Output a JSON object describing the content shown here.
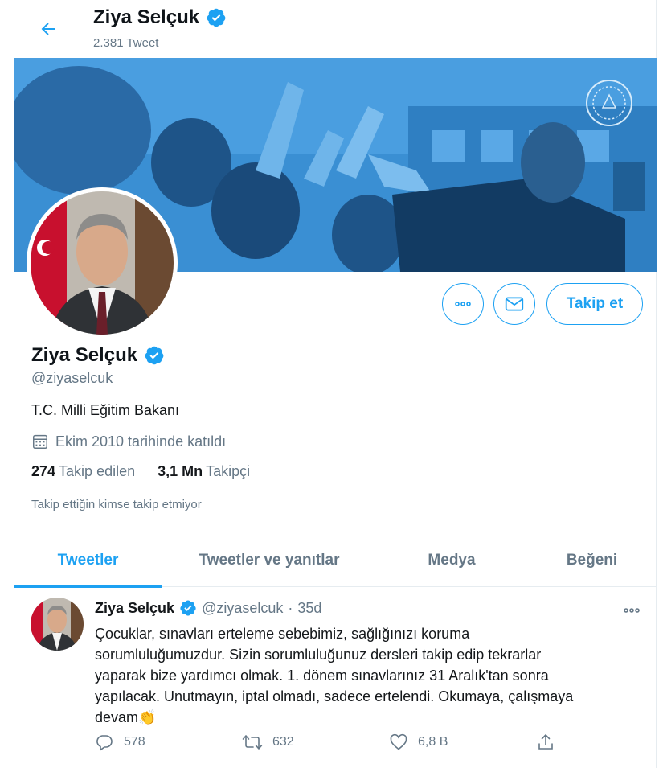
{
  "header": {
    "name": "Ziya Selçuk",
    "tweet_count": "2.381 Tweet"
  },
  "profile": {
    "name": "Ziya Selçuk",
    "handle": "@ziyaselcuk",
    "bio": "T.C. Milli Eğitim Bakanı",
    "joined": "Ekim 2010 tarihinde katıldı",
    "following_count": "274",
    "following_label": "Takip edilen",
    "followers_count": "3,1 Mn",
    "followers_label": "Takipçi",
    "followed_by_note": "Takip ettiğin kimse takip etmiyor"
  },
  "actions": {
    "follow_label": "Takip et"
  },
  "tabs": [
    {
      "label": "Tweetler",
      "active": true
    },
    {
      "label": "Tweetler ve yanıtlar",
      "active": false
    },
    {
      "label": "Medya",
      "active": false
    },
    {
      "label": "Beğeni",
      "active": false
    }
  ],
  "tweet": {
    "name": "Ziya Selçuk",
    "handle": "@ziyaselcuk",
    "separator": "·",
    "time": "35d",
    "text": "Çocuklar, sınavları erteleme sebebimiz, sağlığınızı koruma\nsorumluluğumuzdur. Sizin sorumluluğunuz dersleri takip edip tekrarlar\nyaparak bize yardımcı olmak. 1. dönem sınavlarınız 31 Aralık'tan sonra\nyapılacak. Unutmayın, iptal olmadı, sadece ertelendi. Okumaya, çalışmaya\ndevam",
    "emoji": "👏",
    "reply_count": "578",
    "retweet_count": "632",
    "like_count": "6,8 B"
  },
  "colors": {
    "accent": "#1da1f2",
    "secondary_text": "#657786",
    "banner": "#3a8fd3"
  },
  "icons": [
    "back-arrow-icon",
    "verified-badge-icon",
    "more-icon",
    "mail-icon",
    "calendar-icon",
    "reply-icon",
    "retweet-icon",
    "like-icon",
    "share-icon"
  ]
}
